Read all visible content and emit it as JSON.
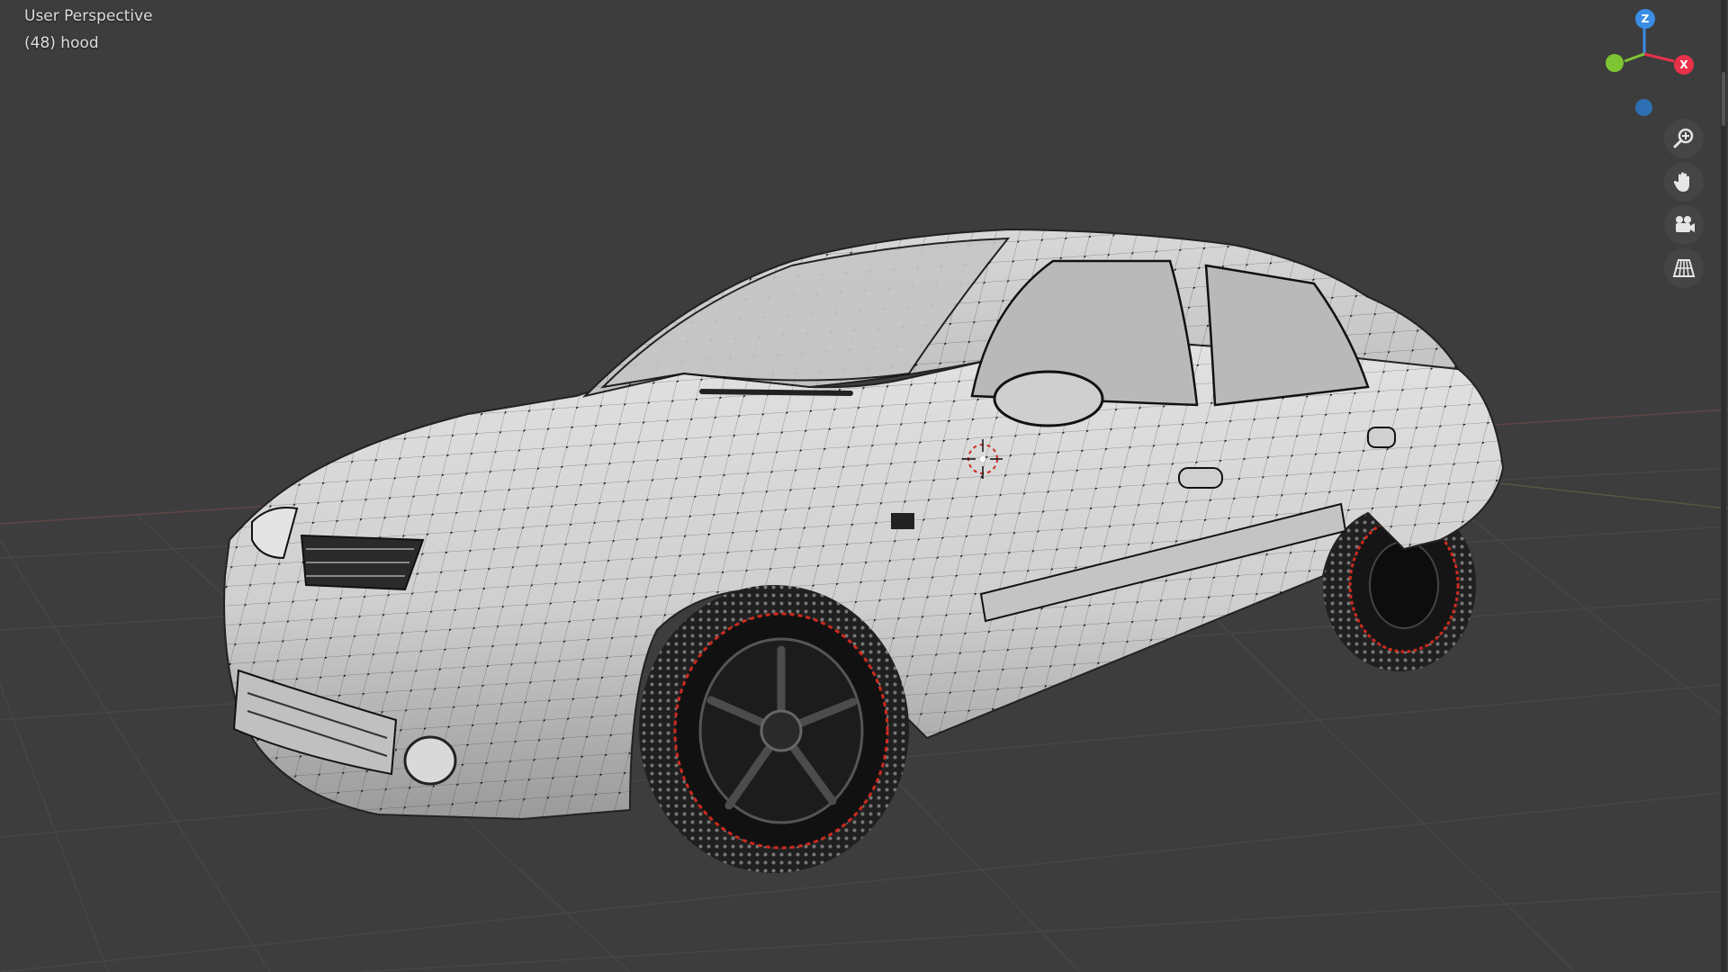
{
  "viewport": {
    "view_name": "User Perspective",
    "object_info": "(48) hood"
  },
  "gizmo": {
    "z_label": "Z",
    "x_label": "X",
    "colors": {
      "z": "#3a8ee6",
      "x": "#e8324a",
      "y": "#7ec534",
      "neg_z": "#2e6fb3",
      "neg_y": "#5c8f2a",
      "neg_x": "#a52a38"
    }
  },
  "nav_buttons": [
    {
      "icon": "zoom-icon"
    },
    {
      "icon": "hand-pan-icon"
    },
    {
      "icon": "camera-icon"
    },
    {
      "icon": "grid-perspective-icon"
    }
  ],
  "scene": {
    "model": "car-sedan-wireframe",
    "mesh_color": "#c8c8c8",
    "vertex_color": "#000000",
    "rim_accent": "#cc2a1e",
    "grid_color": "#4a4a4a"
  }
}
